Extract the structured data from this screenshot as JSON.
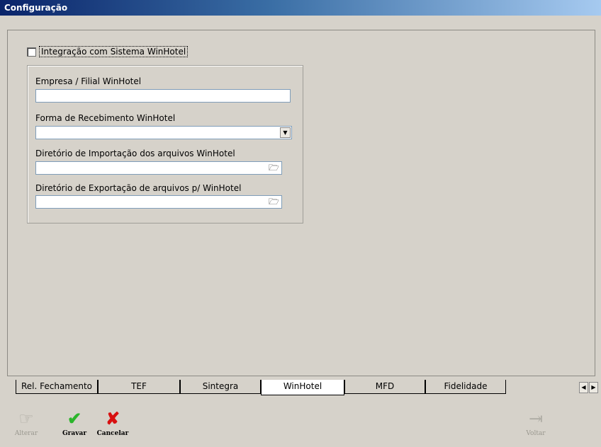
{
  "window": {
    "title": "Configuração"
  },
  "integration": {
    "checkbox_label": "Integração com Sistema WinHotel",
    "checked": false
  },
  "fields": {
    "empresa_label": "Empresa / Filial WinHotel",
    "empresa_value": "",
    "forma_label": "Forma de Recebimento WinHotel",
    "forma_value": "",
    "import_label": "Diretório de Importação dos arquivos WinHotel",
    "import_value": "",
    "export_label": "Diretório de Exportação de arquivos p/ WinHotel",
    "export_value": ""
  },
  "tabs": [
    {
      "label": "Rel. Fechamento"
    },
    {
      "label": "TEF"
    },
    {
      "label": "Sintegra"
    },
    {
      "label": "WinHotel",
      "active": true
    },
    {
      "label": "MFD"
    },
    {
      "label": "Fidelidade"
    }
  ],
  "toolbar": {
    "alterar_label": "Alterar",
    "gravar_label": "Gravar",
    "cancelar_label": "Cancelar",
    "voltar_label": "Voltar"
  },
  "colors": {
    "gravar_icon": "#2bb52b",
    "cancelar_icon": "#d81010"
  }
}
